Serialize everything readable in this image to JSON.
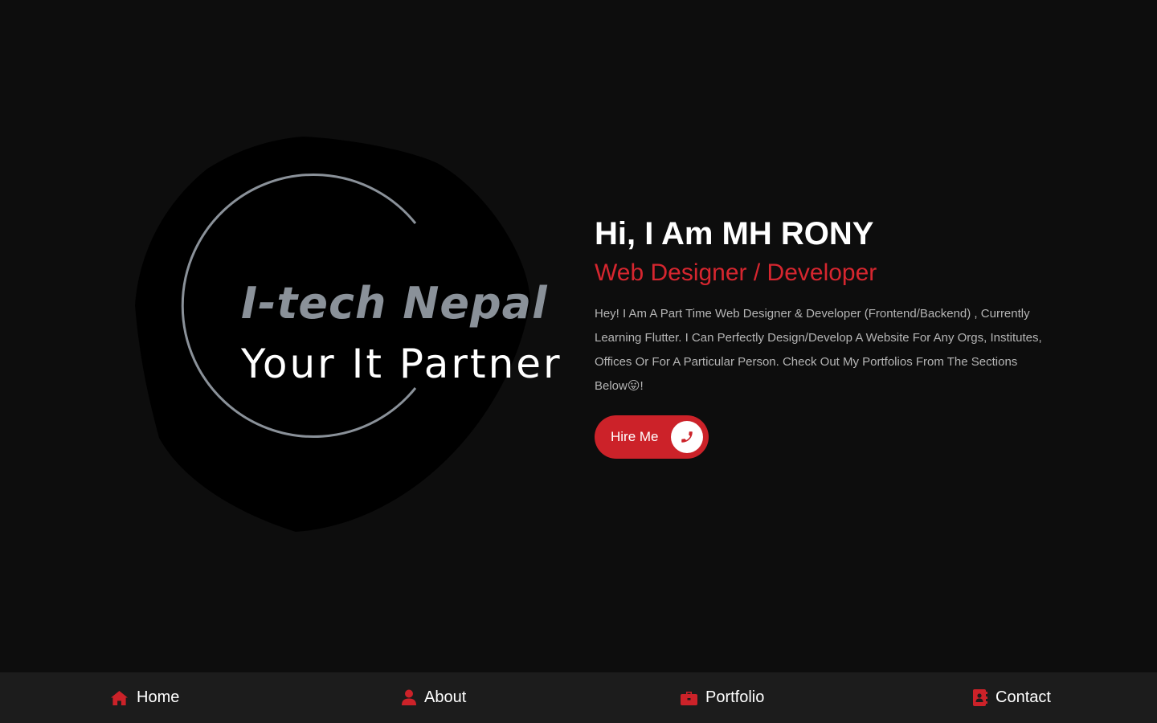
{
  "hero": {
    "logo_line1": "I-tech Nepal",
    "logo_line2": "Your It Partner",
    "title": "Hi, I Am MH RONY",
    "subtitle": "Web Designer / Developer",
    "description": "Hey! I Am A Part Time Web Designer & Developer (Frontend/Backend) , Currently Learning Flutter. I Can Perfectly Design/Develop A Website For Any Orgs, Institutes, Offices Or For A Particular Person. Check Out My Portfolios From The Sections Below😛!",
    "hire_label": "Hire Me",
    "hire_icon": "phone-icon"
  },
  "nav": {
    "items": [
      {
        "label": "Home",
        "icon": "home-icon"
      },
      {
        "label": "About",
        "icon": "user-icon"
      },
      {
        "label": "Portfolio",
        "icon": "briefcase-icon"
      },
      {
        "label": "Contact",
        "icon": "address-book-icon"
      }
    ]
  },
  "colors": {
    "background": "#0d0d0d",
    "accent": "#cc2229",
    "nav_background": "#1c1c1c"
  }
}
